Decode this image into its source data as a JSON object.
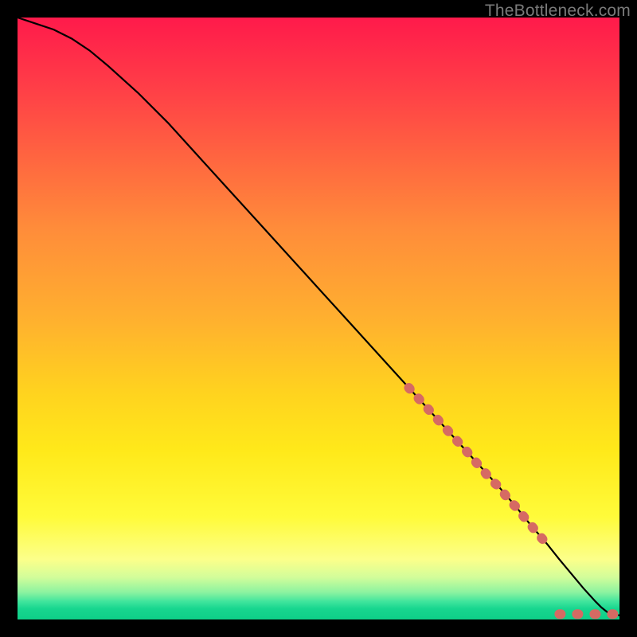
{
  "watermark": "TheBottleneck.com",
  "chart_data": {
    "type": "line",
    "title": "",
    "xlabel": "",
    "ylabel": "",
    "xlim": [
      0,
      100
    ],
    "ylim": [
      0,
      100
    ],
    "grid": false,
    "legend": false,
    "series": [
      {
        "name": "curve",
        "style": "solid-black",
        "x": [
          0,
          3,
          6,
          9,
          12,
          15,
          20,
          25,
          30,
          35,
          40,
          45,
          50,
          55,
          60,
          65,
          70,
          75,
          80,
          83,
          85,
          88,
          90,
          92,
          94,
          95,
          96,
          97,
          98,
          99,
          100
        ],
        "y": [
          100,
          99,
          98,
          96.5,
          94.5,
          92,
          87.5,
          82.5,
          77,
          71.5,
          66,
          60.5,
          55,
          49.5,
          44,
          38.5,
          33,
          27.5,
          22,
          18.5,
          16,
          12.5,
          10,
          7.6,
          5.2,
          4.1,
          3.0,
          2.0,
          1.2,
          0.8,
          0.7
        ]
      },
      {
        "name": "dotted-highlight-upper",
        "style": "salmon-dots",
        "x": [
          65,
          66,
          67,
          68,
          69,
          70,
          71,
          72,
          73,
          74,
          75,
          76,
          77,
          78,
          79,
          80,
          81,
          82,
          83,
          84,
          85,
          86,
          87,
          88
        ],
        "y": [
          38.5,
          37.4,
          36.3,
          35.2,
          34.1,
          33.0,
          31.9,
          30.8,
          29.7,
          28.6,
          27.5,
          26.3,
          25.2,
          24.0,
          22.9,
          22.0,
          20.7,
          19.5,
          18.5,
          17.2,
          16.0,
          14.8,
          13.6,
          12.5
        ]
      },
      {
        "name": "dotted-highlight-lower",
        "style": "salmon-dots",
        "x": [
          90,
          91,
          92,
          93.5,
          95.5,
          96.5,
          99,
          100
        ],
        "y": [
          0.9,
          0.9,
          0.9,
          0.9,
          0.9,
          0.9,
          0.9,
          0.9
        ]
      }
    ],
    "gradient_stops": [
      {
        "pct": 0,
        "color": "#ff1a4b"
      },
      {
        "pct": 12,
        "color": "#ff3f47"
      },
      {
        "pct": 25,
        "color": "#ff6b3f"
      },
      {
        "pct": 35,
        "color": "#ff8c3a"
      },
      {
        "pct": 50,
        "color": "#ffb02f"
      },
      {
        "pct": 62,
        "color": "#ffd21f"
      },
      {
        "pct": 72,
        "color": "#ffe91a"
      },
      {
        "pct": 83,
        "color": "#fffb3a"
      },
      {
        "pct": 90,
        "color": "#fcff8a"
      },
      {
        "pct": 93,
        "color": "#d2fd9a"
      },
      {
        "pct": 95.5,
        "color": "#8bf3a0"
      },
      {
        "pct": 97,
        "color": "#41e59d"
      },
      {
        "pct": 98.2,
        "color": "#18d68f"
      },
      {
        "pct": 100,
        "color": "#0ecf88"
      }
    ],
    "colors": {
      "curve": "#000000",
      "dots": "#d66a63"
    }
  }
}
